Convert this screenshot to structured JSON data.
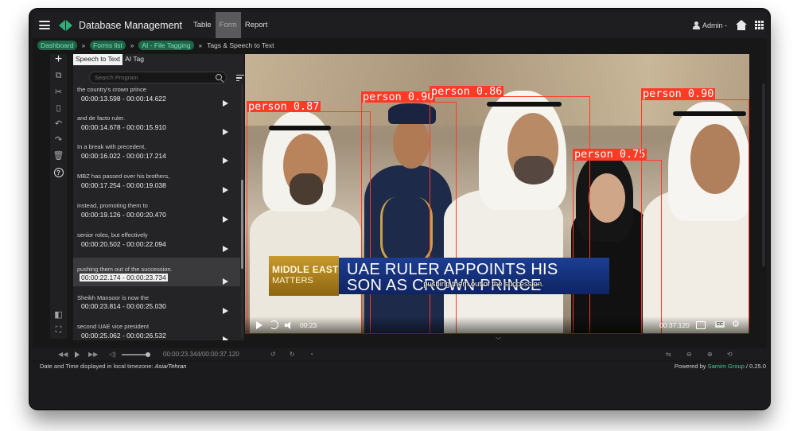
{
  "app": {
    "title": "Database Management"
  },
  "nav": {
    "items": [
      "Table",
      "Form",
      "Report"
    ],
    "active": "Form"
  },
  "user": {
    "label": "Admin -"
  },
  "breadcrumb": {
    "items": [
      "Dashboard",
      "Forms list",
      "AI - File Tagging"
    ],
    "current": "Tags & Speech to Text"
  },
  "panel": {
    "tabs": [
      "Speech to Text",
      "AI Tag"
    ],
    "search_placeholder": "Search Program",
    "segments": [
      {
        "text": "the country's crown prince",
        "time": "00:00:13.598 - 00:00:14.622"
      },
      {
        "text": "and de facto ruler.",
        "time": "00:00:14.678 - 00:00:15.910"
      },
      {
        "text": "In a break with precedent,",
        "time": "00:00:16.022 - 00:00:17.214"
      },
      {
        "text": "MBZ has passed over his brothers,",
        "time": "00:00:17.254 - 00:00:19.038"
      },
      {
        "text": "instead, promoting them to",
        "time": "00:00:19.126 - 00:00:20.470"
      },
      {
        "text": "senior roles, but effectively",
        "time": "00:00:20.502 - 00:00:22.094"
      },
      {
        "text": "pushing them out of the succession.",
        "time": "00:00:22.174 - 00:00:23.734",
        "selected": true
      },
      {
        "text": "Sheikh Mansoor is now the",
        "time": "00:00:23.814 - 00:00:25.030"
      },
      {
        "text": "second UAE vice president",
        "time": "00:00:25.062 - 00:00:26.532"
      }
    ]
  },
  "video": {
    "detections": [
      {
        "label": "person 0.87"
      },
      {
        "label": "person 0.90"
      },
      {
        "label": "person 0.86"
      },
      {
        "label": "person 0.75"
      },
      {
        "label": "person 0.90"
      }
    ],
    "lower_third": {
      "brand_line1": "MIDDLE EAST",
      "brand_line2": "MATTERS",
      "headline_line1": "UAE RULER APPOINTS HIS",
      "headline_line2": "SON AS CROWN PRINCE"
    },
    "subtitle": "pushing them out of the succession.",
    "current_time": "00:23",
    "duration": "00:37.120",
    "cc_label": "CC"
  },
  "timeline": {
    "position": "00:00:23.344",
    "duration": "00:00:37.120"
  },
  "footer": {
    "timezone_prefix": "Date and Time displayed in local timezone:",
    "timezone": "Asia/Tehran",
    "powered_prefix": "Powered by",
    "brand": "Samim Group",
    "version": "/ 0.25.0"
  },
  "colors": {
    "accent": "#2fae79",
    "detection": "#ff3a25",
    "breadcrumb_pill": "#1f6649"
  }
}
